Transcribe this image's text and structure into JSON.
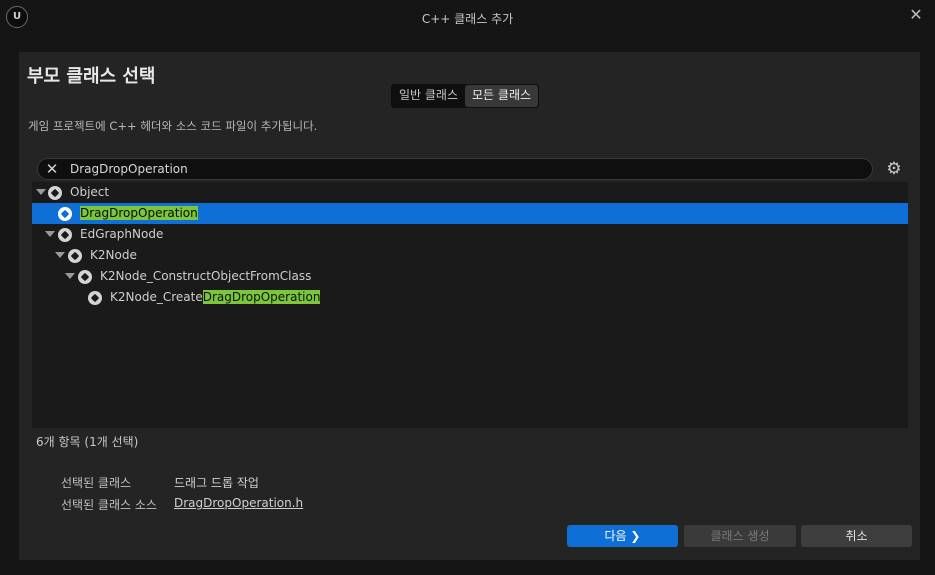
{
  "window": {
    "title": "C++ 클래스 추가",
    "logo_text": "U",
    "close_symbol": "✕"
  },
  "heading": "부모 클래스 선택",
  "filter_tabs": [
    {
      "label": "일반 클래스",
      "active": false
    },
    {
      "label": "모든 클래스",
      "active": true
    }
  ],
  "description": "게임 프로젝트에 C++ 헤더와 소스 코드 파일이 추가됩니다.",
  "search": {
    "value": "DragDropOperation",
    "clear_icon": "close-icon"
  },
  "settings_icon": "gear-icon",
  "tree": [
    {
      "prefix": "",
      "match": "",
      "suffix": "Object",
      "expanded": true,
      "selected": false,
      "depth": 0
    },
    {
      "prefix": "",
      "match": "DragDropOperation",
      "suffix": "",
      "expanded": null,
      "selected": true,
      "depth": 1
    },
    {
      "prefix": "",
      "match": "",
      "suffix": "EdGraphNode",
      "expanded": true,
      "selected": false,
      "depth": 1
    },
    {
      "prefix": "",
      "match": "",
      "suffix": "K2Node",
      "expanded": true,
      "selected": false,
      "depth": 2
    },
    {
      "prefix": "",
      "match": "",
      "suffix": "K2Node_ConstructObjectFromClass",
      "expanded": true,
      "selected": false,
      "depth": 3
    },
    {
      "prefix": "K2Node_Create",
      "match": "DragDropOperation",
      "suffix": "",
      "expanded": null,
      "selected": false,
      "depth": 4
    }
  ],
  "item_count": "6개 항목 (1개 선택)",
  "info": {
    "selected_class_label": "선택된 클래스",
    "selected_class_value": "드래그 드롭 작업",
    "selected_source_label": "선택된 클래스 소스",
    "selected_source_value": "DragDropOperation.h"
  },
  "buttons": {
    "next": "다음 ❯",
    "create": "클래스 생성",
    "cancel": "취소"
  },
  "colors": {
    "accent": "#0e70d6",
    "highlight": "#7cc63a",
    "background": "#151515",
    "panel": "#242424"
  }
}
